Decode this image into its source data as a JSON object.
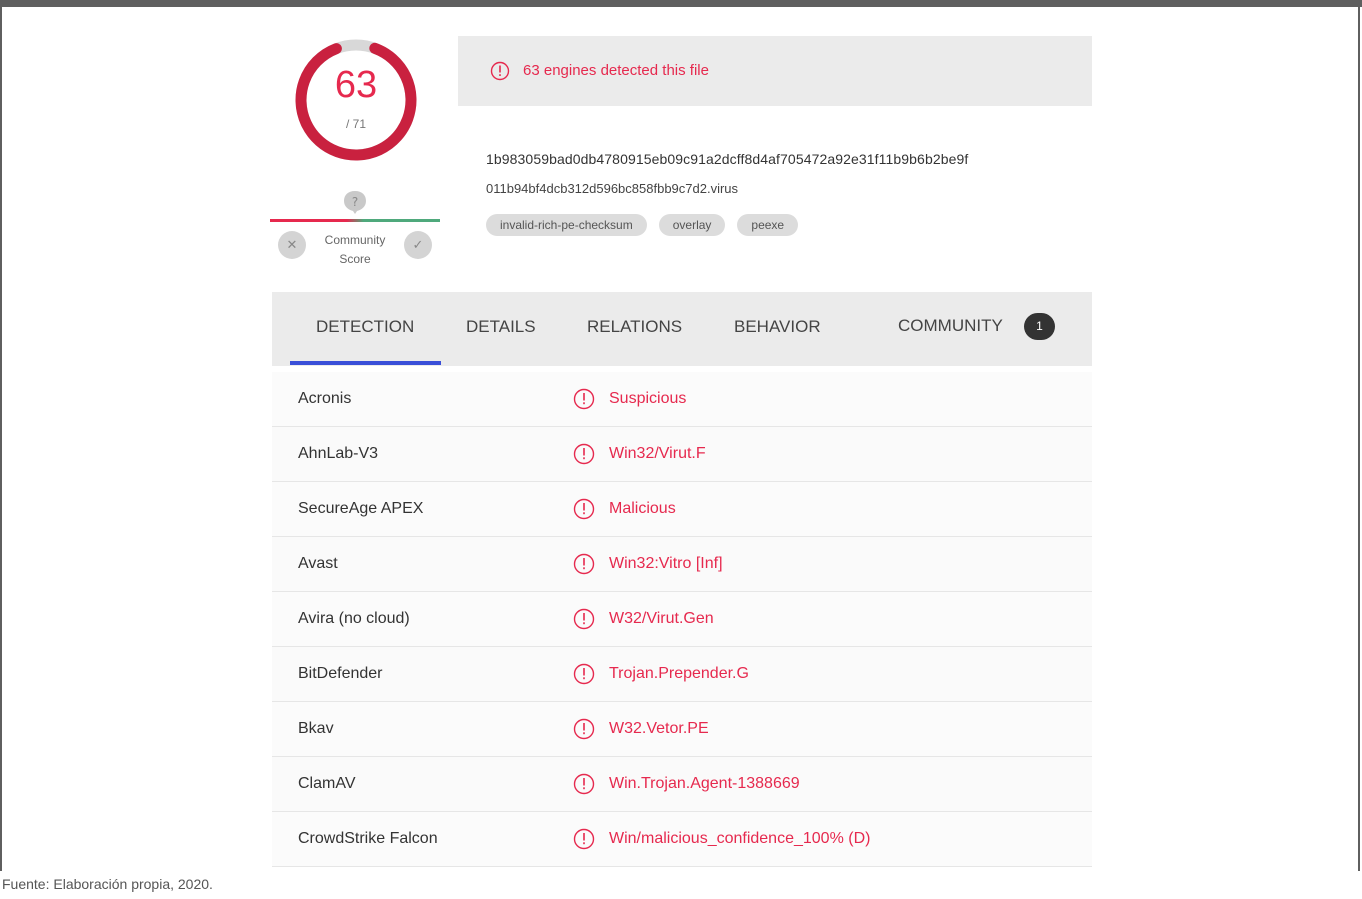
{
  "score": {
    "detected": "63",
    "total": "/ 71"
  },
  "community": {
    "label_line1": "Community",
    "label_line2": "Score",
    "down_icon": "x-icon",
    "up_icon": "check-icon",
    "question_icon": "question-icon"
  },
  "banner": {
    "text": "63 engines detected this file"
  },
  "file": {
    "hash": "1b983059bad0db4780915eb09c91a2dcff8d4af705472a92e31f11b9b6b2be9f",
    "name": "011b94bf4dcb312d596bc858fbb9c7d2.virus",
    "tags": [
      "invalid-rich-pe-checksum",
      "overlay",
      "peexe"
    ]
  },
  "tabs": {
    "detection": "DETECTION",
    "details": "DETAILS",
    "relations": "RELATIONS",
    "behavior": "BEHAVIOR",
    "community": "COMMUNITY",
    "community_count": "1"
  },
  "detections": [
    {
      "engine": "Acronis",
      "result": "Suspicious"
    },
    {
      "engine": "AhnLab-V3",
      "result": "Win32/Virut.F"
    },
    {
      "engine": "SecureAge APEX",
      "result": "Malicious"
    },
    {
      "engine": "Avast",
      "result": "Win32:Vitro [Inf]"
    },
    {
      "engine": "Avira (no cloud)",
      "result": "W32/Virut.Gen"
    },
    {
      "engine": "BitDefender",
      "result": "Trojan.Prepender.G"
    },
    {
      "engine": "Bkav",
      "result": "W32.Vetor.PE"
    },
    {
      "engine": "ClamAV",
      "result": "Win.Trojan.Agent-1388669"
    },
    {
      "engine": "CrowdStrike Falcon",
      "result": "Win/malicious_confidence_100% (D)"
    }
  ],
  "caption": "Fuente: Elaboración propia, 2020.",
  "colors": {
    "malicious": "#e6294e",
    "tab_active": "#3a4fd8",
    "harmless": "#4fa97c"
  }
}
